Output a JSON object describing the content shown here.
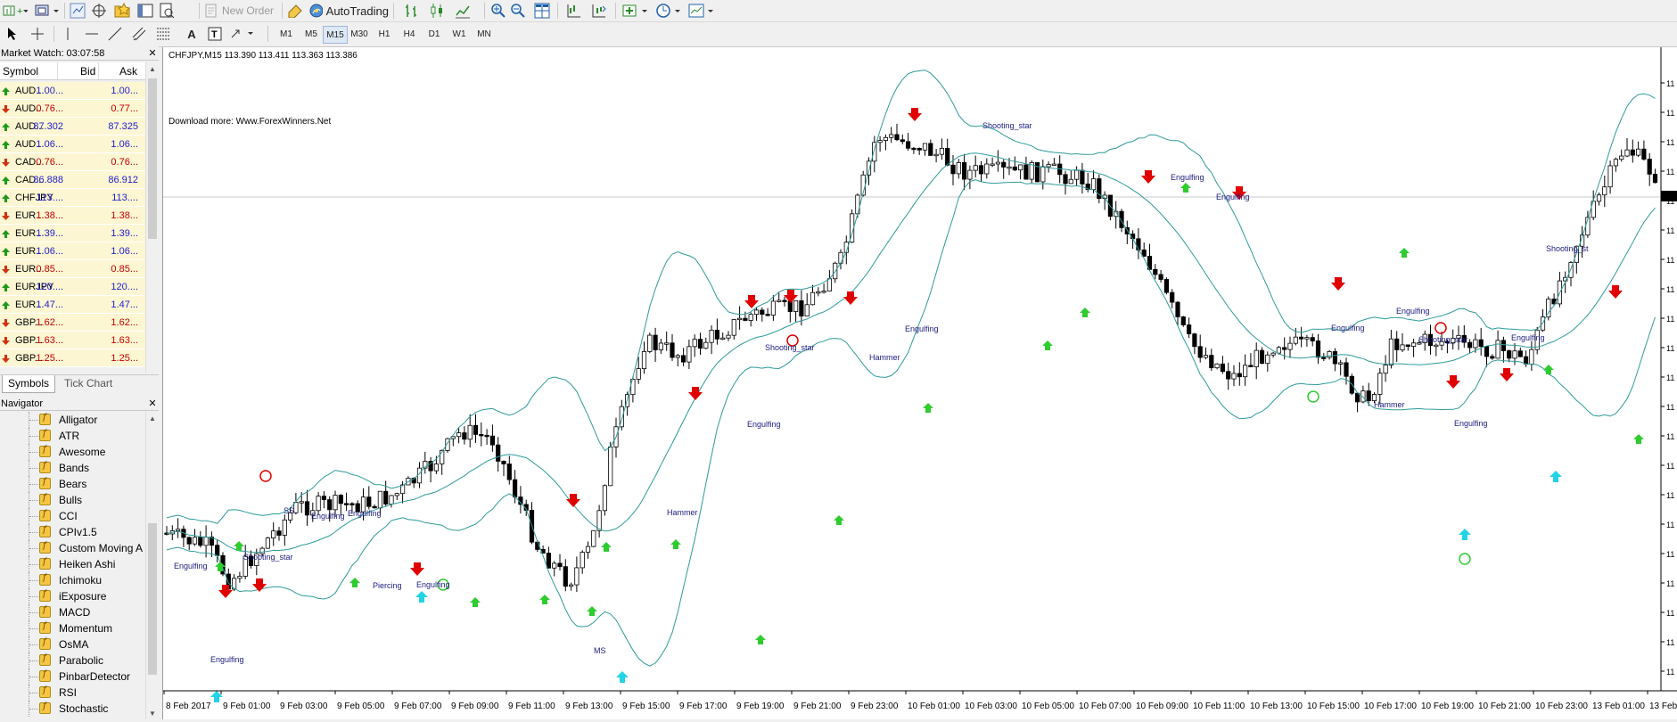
{
  "toolbar": {
    "new_order_label": "New Order",
    "autotrading_label": "AutoTrading",
    "timeframes": [
      "M1",
      "M5",
      "M15",
      "M30",
      "H1",
      "H4",
      "D1",
      "W1",
      "MN"
    ],
    "active_timeframe": "M15"
  },
  "market_watch": {
    "title": "Market Watch: 03:07:58",
    "columns": {
      "symbol": "Symbol",
      "bid": "Bid",
      "ask": "Ask"
    },
    "rows": [
      {
        "symbol": "AUD...",
        "bid": "1.00...",
        "ask": "1.00...",
        "dir": "up",
        "color": "blue"
      },
      {
        "symbol": "AUD...",
        "bid": "0.76...",
        "ask": "0.77...",
        "dir": "down",
        "color": "red"
      },
      {
        "symbol": "AUD...",
        "bid": "87.302",
        "ask": "87.325",
        "dir": "up",
        "color": "blue"
      },
      {
        "symbol": "AUD...",
        "bid": "1.06...",
        "ask": "1.06...",
        "dir": "up",
        "color": "blue"
      },
      {
        "symbol": "CAD...",
        "bid": "0.76...",
        "ask": "0.76...",
        "dir": "down",
        "color": "red"
      },
      {
        "symbol": "CAD...",
        "bid": "86.888",
        "ask": "86.912",
        "dir": "up",
        "color": "blue"
      },
      {
        "symbol": "CHFJPY",
        "bid": "113....",
        "ask": "113....",
        "dir": "up",
        "color": "blue"
      },
      {
        "symbol": "EUR...",
        "bid": "1.38...",
        "ask": "1.38...",
        "dir": "down",
        "color": "red"
      },
      {
        "symbol": "EUR...",
        "bid": "1.39...",
        "ask": "1.39...",
        "dir": "up",
        "color": "blue"
      },
      {
        "symbol": "EUR...",
        "bid": "1.06...",
        "ask": "1.06...",
        "dir": "up",
        "color": "blue"
      },
      {
        "symbol": "EUR...",
        "bid": "0.85...",
        "ask": "0.85...",
        "dir": "down",
        "color": "red"
      },
      {
        "symbol": "EURJPY",
        "bid": "120....",
        "ask": "120....",
        "dir": "up",
        "color": "blue"
      },
      {
        "symbol": "EUR...",
        "bid": "1.47...",
        "ask": "1.47...",
        "dir": "up",
        "color": "blue"
      },
      {
        "symbol": "GBP...",
        "bid": "1.62...",
        "ask": "1.62...",
        "dir": "down",
        "color": "red"
      },
      {
        "symbol": "GBP...",
        "bid": "1.63...",
        "ask": "1.63...",
        "dir": "down",
        "color": "red"
      },
      {
        "symbol": "GBP...",
        "bid": "1.25...",
        "ask": "1.25...",
        "dir": "down",
        "color": "red"
      }
    ],
    "tabs": [
      "Symbols",
      "Tick Chart"
    ]
  },
  "navigator": {
    "title": "Navigator",
    "items": [
      "Alligator",
      "ATR",
      "Awesome",
      "Bands",
      "Bears",
      "Bulls",
      "CCI",
      "CPIv1.5",
      "Custom Moving A",
      "Heiken Ashi",
      "Ichimoku",
      "iExposure",
      "MACD",
      "Momentum",
      "OsMA",
      "Parabolic",
      "PinbarDetector",
      "RSI",
      "Stochastic"
    ]
  },
  "chart": {
    "header": "CHFJPY,M15  113.390 113.411 113.363 113.386",
    "note": "Download more: Www.ForexWinners.Net",
    "time_labels": [
      "8 Feb 2017",
      "9 Feb 01:00",
      "9 Feb 03:00",
      "9 Feb 05:00",
      "9 Feb 07:00",
      "9 Feb 09:00",
      "9 Feb 11:00",
      "9 Feb 13:00",
      "9 Feb 15:00",
      "9 Feb 17:00",
      "9 Feb 19:00",
      "9 Feb 21:00",
      "9 Feb 23:00",
      "10 Feb 01:00",
      "10 Feb 03:00",
      "10 Feb 05:00",
      "10 Feb 07:00",
      "10 Feb 09:00",
      "10 Feb 11:00",
      "10 Feb 13:00",
      "10 Feb 15:00",
      "10 Feb 17:00",
      "10 Feb 19:00",
      "10 Feb 21:00",
      "10 Feb 23:00",
      "13 Feb 01:00",
      "13 Feb"
    ],
    "price_tick_label": "11",
    "patterns": [
      {
        "text": "Engulfing"
      },
      {
        "text": "Engulfing"
      },
      {
        "text": "Shooting_star"
      },
      {
        "text": "SS"
      },
      {
        "text": "Engulfing"
      },
      {
        "text": "Engulfing"
      },
      {
        "text": "Piercing"
      },
      {
        "text": "Engulfing"
      },
      {
        "text": "MS"
      },
      {
        "text": "Hammer"
      },
      {
        "text": "Engulfing"
      },
      {
        "text": "Shooting_star"
      },
      {
        "text": "Hammer"
      },
      {
        "text": "Engulfing"
      },
      {
        "text": "Shooting_star"
      },
      {
        "text": "Engulfing"
      },
      {
        "text": "Engulfing"
      },
      {
        "text": "Engulfing"
      },
      {
        "text": "Engulfing"
      },
      {
        "text": "Hammer"
      },
      {
        "text": "Shooting_star"
      },
      {
        "text": "Engulfing"
      },
      {
        "text": "Engulfing"
      },
      {
        "text": "Shooting_st"
      }
    ],
    "colors": {
      "band": "#2e9a9a",
      "bull": "#ffffff",
      "bear": "#000000",
      "down_arrow": "#e00000",
      "up_arrow": "#2ecc2e",
      "cyan_arrow": "#22d3e6",
      "label": "#1a1a80"
    }
  }
}
